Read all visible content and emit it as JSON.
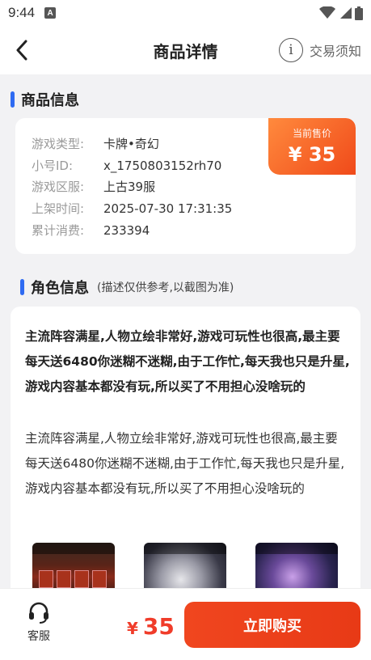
{
  "status_bar": {
    "time": "9:44",
    "notification_badge": "A"
  },
  "header": {
    "title": "商品详情",
    "notice_icon": "i",
    "notice_label": "交易须知"
  },
  "product_section": {
    "title": "商品信息"
  },
  "product_info": {
    "rows": [
      {
        "label": "游戏类型:",
        "value": "卡牌•奇幻"
      },
      {
        "label": "小号ID:",
        "value": "x_1750803152rh70"
      },
      {
        "label": "游戏区服:",
        "value": "上古39服"
      },
      {
        "label": "上架时间:",
        "value": "2025-07-30 17:31:35"
      },
      {
        "label": "累计消费:",
        "value": "233394"
      }
    ],
    "price_label": "当前售价",
    "price_value": "¥ 35"
  },
  "role_section": {
    "title": "角色信息",
    "note": "(描述仅供参考,以截图为准)"
  },
  "role_info": {
    "bold_text": "主流阵容满星,人物立绘非常好,游戏可玩性也很高,最主要每天送6480你迷糊不迷糊,由于工作忙,每天我也只是升星,游戏内容基本都没有玩,所以买了不用担心没啥玩的",
    "normal_text": "主流阵容满星,人物立绘非常好,游戏可玩性也很高,最主要每天送6480你迷糊不迷糊,由于工作忙,每天我也只是升星,游戏内容基本都没有玩,所以买了不用担心没啥玩的"
  },
  "bottom_bar": {
    "service_label": "客服",
    "price_currency": "¥",
    "price_amount": "35",
    "buy_label": "立即购买"
  },
  "colors": {
    "accent_blue": "#2f6bf2",
    "price_red": "#f03c2a",
    "buy_orange": "#e83a16"
  }
}
